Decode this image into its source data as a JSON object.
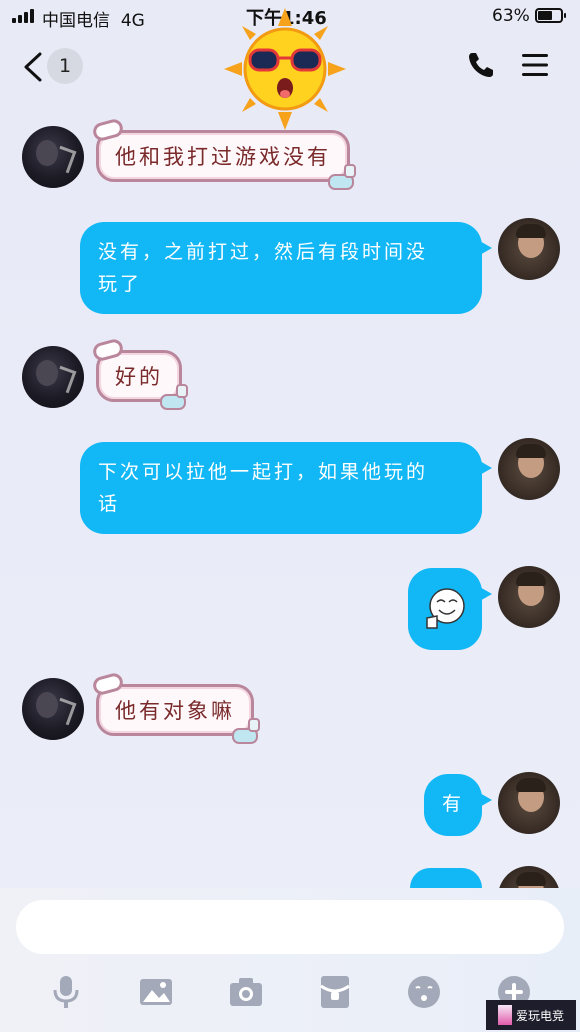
{
  "status_bar": {
    "carrier": "中国电信",
    "network": "4G",
    "time": "下午1:46",
    "battery_percent": "63%",
    "battery_level": 0.63
  },
  "header": {
    "unread_count": "1",
    "icons": [
      "back-icon",
      "phone-icon",
      "menu-icon"
    ]
  },
  "messages": [
    {
      "side": "in",
      "text": "他和我打过游戏没有"
    },
    {
      "side": "out",
      "lines": [
        "没有，之前打过，然后有段时间没",
        "玩了"
      ]
    },
    {
      "side": "in",
      "text": "好的"
    },
    {
      "side": "out",
      "lines": [
        "下次可以拉他一起打，如果他玩的",
        "话"
      ]
    },
    {
      "side": "out",
      "sticker": "thumbs-up-face-sticker"
    },
    {
      "side": "in",
      "text": "他有对象嘛"
    },
    {
      "side": "out",
      "text": "有"
    }
  ],
  "input": {
    "placeholder": ""
  },
  "toolbar": {
    "icons": [
      "microphone-icon",
      "image-icon",
      "camera-icon",
      "red-packet-icon",
      "emoji-icon",
      "plus-icon"
    ]
  },
  "watermark": {
    "text": "爱玩电竞"
  },
  "colors": {
    "outgoing_bubble": "#12b7f5",
    "incoming_text": "#7a2a2a",
    "background": "#e8eaf6"
  }
}
